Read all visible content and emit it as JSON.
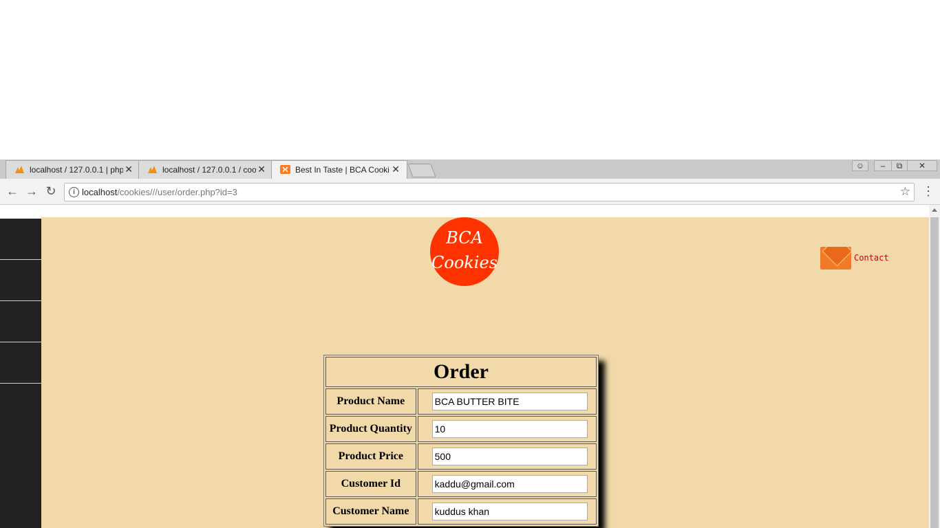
{
  "browser": {
    "tabs": [
      {
        "title": "localhost / 127.0.0.1 | php",
        "icon": "phpmyadmin-icon",
        "active": false
      },
      {
        "title": "localhost / 127.0.0.1 / coo",
        "icon": "phpmyadmin-icon",
        "active": false
      },
      {
        "title": "Best In Taste | BCA Cooki",
        "icon": "xampp-icon",
        "active": true
      }
    ],
    "close_glyph": "✕",
    "url_host": "localhost",
    "url_path": "/cookies///user/order.php?id=3"
  },
  "page": {
    "logo": {
      "line1": "BCA",
      "line2": "Cookies",
      "color": "#ff3300"
    },
    "contact_label": "Contact",
    "background": "#f2d9aa",
    "order": {
      "title": "Order",
      "fields": [
        {
          "label": "Product Name",
          "value": "BCA BUTTER BITE"
        },
        {
          "label": "Product Quantity",
          "value": "10"
        },
        {
          "label": "Product Price",
          "value": "500"
        },
        {
          "label": "Customer Id",
          "value": "kaddu@gmail.com"
        },
        {
          "label": "Customer Name",
          "value": "kuddus khan"
        }
      ]
    }
  }
}
